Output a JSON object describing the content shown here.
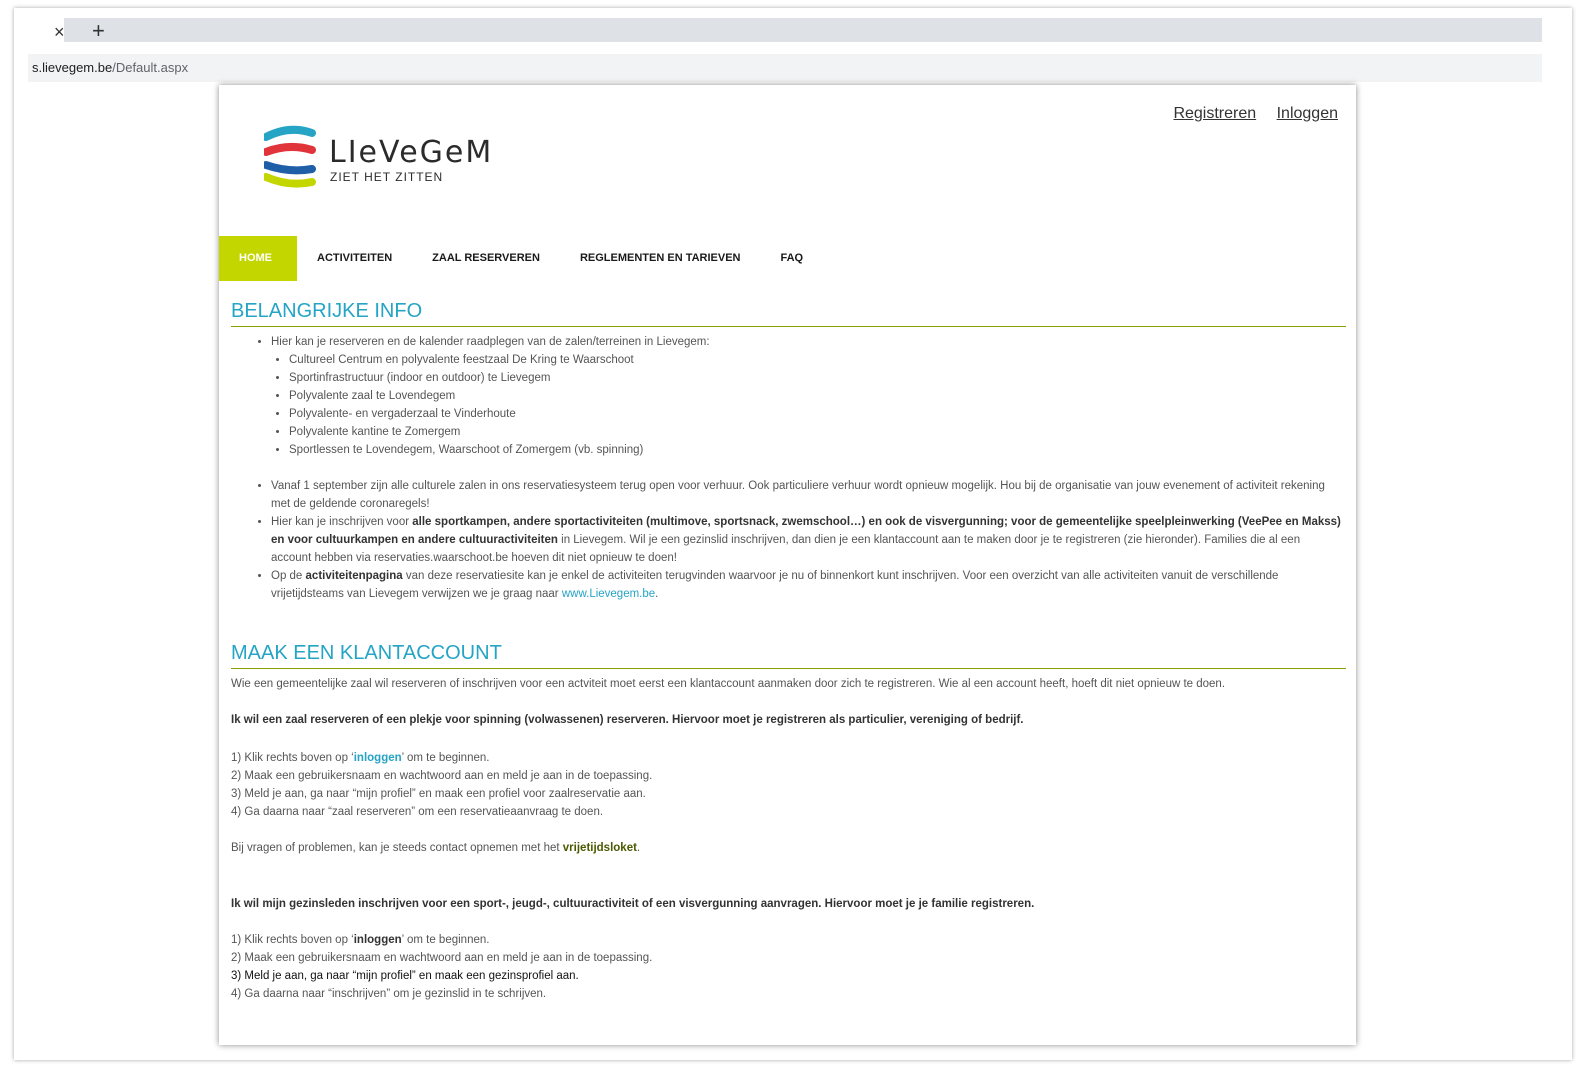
{
  "browser": {
    "tab_close": "×",
    "tab_new": "+",
    "url_host": "s.lievegem.be",
    "url_path": "/Default.aspx"
  },
  "header": {
    "register_link": "Registreren",
    "login_link": "Inloggen",
    "logo_name": "LIeVeGeM",
    "logo_tagline": "ZIET HET ZITTEN"
  },
  "nav": {
    "items": [
      "HOME",
      "ACTIVITEITEN",
      "ZAAL RESERVEREN",
      "REGLEMENTEN EN TARIEVEN",
      "FAQ"
    ]
  },
  "info": {
    "title": "BELANGRIJKE INFO",
    "intro": "Hier kan je reserveren en de kalender raadplegen van de zalen/terreinen in Lievegem:",
    "venues": [
      "Cultureel Centrum en polyvalente feestzaal De Kring te Waarschoot",
      "Sportinfrastructuur (indoor en outdoor) te Lievegem",
      "Polyvalente zaal te Lovendegem",
      "Polyvalente- en vergaderzaal te Vinderhoute",
      "Polyvalente kantine te Zomergem",
      "Sportlessen te Lovendegem, Waarschoot of Zomergem (vb. spinning)"
    ],
    "b1": "Vanaf 1 september zijn alle culturele zalen in ons reservatiesysteem terug open voor verhuur. Ook particuliere verhuur wordt opnieuw mogelijk. Hou bij de organisatie van jouw evenement of activiteit rekening met de geldende coronaregels!",
    "b2_a": "Hier kan je inschrijven voor ",
    "b2_bold": "alle sportkampen, andere sportactiviteiten (multimove, sportsnack, zwemschool…) en ook de visvergunning; voor de gemeentelijke speelpleinwerking (VeePee en Makss) en voor cultuurkampen en andere cultuuractiviteiten",
    "b2_b": " in Lievegem. Wil je een gezinslid inschrijven, dan dien je een klantaccount aan te maken door je te registreren (zie hieronder). Families die al een account hebben via reservaties.waarschoot.be hoeven dit niet opnieuw te doen!",
    "b3_a": "Op de ",
    "b3_bold": "activiteitenpagina",
    "b3_b": " van deze reservatiesite kan je enkel de activiteiten terugvinden waarvoor je nu of binnenkort kunt inschrijven. Voor een overzicht van alle activiteiten vanuit de verschillende vrijetijdsteams van Lievegem verwijzen we je graag naar ",
    "b3_link": "www.Lievegem.be",
    "b3_end": "."
  },
  "account": {
    "title": "MAAK EEN KLANTACCOUNT",
    "intro": "Wie een gemeentelijke zaal wil reserveren of inschrijven voor een actviteit moet eerst een klantaccount aanmaken door zich te registreren. Wie al een account heeft, hoeft dit niet opnieuw te doen.",
    "heading1": "Ik wil een zaal reserveren of een plekje voor spinning (volwassenen) reserveren. Hiervoor moet je registreren als particulier, vereniging of bedrijf.",
    "s1_1a": "1)  Klik rechts boven op ‘",
    "s1_1link": "inloggen",
    "s1_1b": "’ om te beginnen.",
    "s1_2": "2)  Maak een gebruikersnaam en wachtwoord aan en meld je aan in de toepassing.",
    "s1_3": "3)  Meld je aan, ga naar “mijn profiel” en maak een profiel voor zaalreservatie aan.",
    "s1_4": "4)  Ga daarna naar “zaal reserveren” om een reservatieaanvraag te doen.",
    "help_a": "Bij vragen of problemen, kan je steeds contact opnemen met het ",
    "help_bold": "vrijetijdsloket",
    "help_b": ".",
    "heading2": "Ik wil mijn gezinsleden inschrijven voor een sport-, jeugd-, cultuuractiviteit of een visvergunning aanvragen. Hiervoor moet je je familie registreren.",
    "s2_1a": "1)  Klik rechts boven op ‘",
    "s2_1bold": "inloggen",
    "s2_1b": "’ om te beginnen.",
    "s2_2": "2)  Maak een gebruikersnaam en wachtwoord aan en meld je aan in de toepassing.",
    "s2_3": "3)  Meld je aan, ga naar “mijn profiel” en maak een gezinsprofiel aan.",
    "s2_4": "4)  Ga daarna naar “inschrijven” om je gezinslid in te schrijven."
  },
  "colors": {
    "accent": "#25a4c5",
    "nav_active": "#c4d600",
    "divider": "#8aa000"
  }
}
